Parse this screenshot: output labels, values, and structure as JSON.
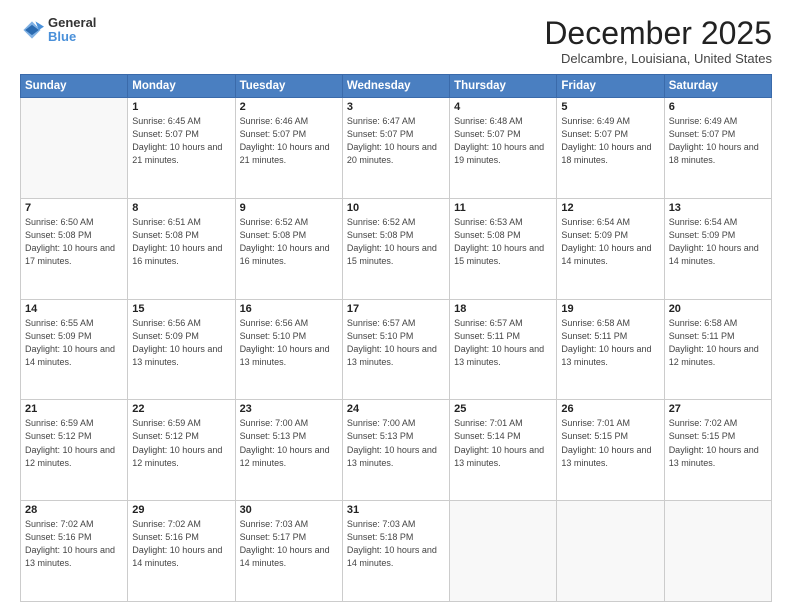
{
  "logo": {
    "general": "General",
    "blue": "Blue"
  },
  "header": {
    "month": "December 2025",
    "location": "Delcambre, Louisiana, United States"
  },
  "weekdays": [
    "Sunday",
    "Monday",
    "Tuesday",
    "Wednesday",
    "Thursday",
    "Friday",
    "Saturday"
  ],
  "weeks": [
    [
      {
        "day": "",
        "empty": true
      },
      {
        "day": "1",
        "sunrise": "6:45 AM",
        "sunset": "5:07 PM",
        "daylight": "10 hours and 21 minutes."
      },
      {
        "day": "2",
        "sunrise": "6:46 AM",
        "sunset": "5:07 PM",
        "daylight": "10 hours and 21 minutes."
      },
      {
        "day": "3",
        "sunrise": "6:47 AM",
        "sunset": "5:07 PM",
        "daylight": "10 hours and 20 minutes."
      },
      {
        "day": "4",
        "sunrise": "6:48 AM",
        "sunset": "5:07 PM",
        "daylight": "10 hours and 19 minutes."
      },
      {
        "day": "5",
        "sunrise": "6:49 AM",
        "sunset": "5:07 PM",
        "daylight": "10 hours and 18 minutes."
      },
      {
        "day": "6",
        "sunrise": "6:49 AM",
        "sunset": "5:07 PM",
        "daylight": "10 hours and 18 minutes."
      }
    ],
    [
      {
        "day": "7",
        "sunrise": "6:50 AM",
        "sunset": "5:08 PM",
        "daylight": "10 hours and 17 minutes."
      },
      {
        "day": "8",
        "sunrise": "6:51 AM",
        "sunset": "5:08 PM",
        "daylight": "10 hours and 16 minutes."
      },
      {
        "day": "9",
        "sunrise": "6:52 AM",
        "sunset": "5:08 PM",
        "daylight": "10 hours and 16 minutes."
      },
      {
        "day": "10",
        "sunrise": "6:52 AM",
        "sunset": "5:08 PM",
        "daylight": "10 hours and 15 minutes."
      },
      {
        "day": "11",
        "sunrise": "6:53 AM",
        "sunset": "5:08 PM",
        "daylight": "10 hours and 15 minutes."
      },
      {
        "day": "12",
        "sunrise": "6:54 AM",
        "sunset": "5:09 PM",
        "daylight": "10 hours and 14 minutes."
      },
      {
        "day": "13",
        "sunrise": "6:54 AM",
        "sunset": "5:09 PM",
        "daylight": "10 hours and 14 minutes."
      }
    ],
    [
      {
        "day": "14",
        "sunrise": "6:55 AM",
        "sunset": "5:09 PM",
        "daylight": "10 hours and 14 minutes."
      },
      {
        "day": "15",
        "sunrise": "6:56 AM",
        "sunset": "5:09 PM",
        "daylight": "10 hours and 13 minutes."
      },
      {
        "day": "16",
        "sunrise": "6:56 AM",
        "sunset": "5:10 PM",
        "daylight": "10 hours and 13 minutes."
      },
      {
        "day": "17",
        "sunrise": "6:57 AM",
        "sunset": "5:10 PM",
        "daylight": "10 hours and 13 minutes."
      },
      {
        "day": "18",
        "sunrise": "6:57 AM",
        "sunset": "5:11 PM",
        "daylight": "10 hours and 13 minutes."
      },
      {
        "day": "19",
        "sunrise": "6:58 AM",
        "sunset": "5:11 PM",
        "daylight": "10 hours and 13 minutes."
      },
      {
        "day": "20",
        "sunrise": "6:58 AM",
        "sunset": "5:11 PM",
        "daylight": "10 hours and 12 minutes."
      }
    ],
    [
      {
        "day": "21",
        "sunrise": "6:59 AM",
        "sunset": "5:12 PM",
        "daylight": "10 hours and 12 minutes."
      },
      {
        "day": "22",
        "sunrise": "6:59 AM",
        "sunset": "5:12 PM",
        "daylight": "10 hours and 12 minutes."
      },
      {
        "day": "23",
        "sunrise": "7:00 AM",
        "sunset": "5:13 PM",
        "daylight": "10 hours and 12 minutes."
      },
      {
        "day": "24",
        "sunrise": "7:00 AM",
        "sunset": "5:13 PM",
        "daylight": "10 hours and 13 minutes."
      },
      {
        "day": "25",
        "sunrise": "7:01 AM",
        "sunset": "5:14 PM",
        "daylight": "10 hours and 13 minutes."
      },
      {
        "day": "26",
        "sunrise": "7:01 AM",
        "sunset": "5:15 PM",
        "daylight": "10 hours and 13 minutes."
      },
      {
        "day": "27",
        "sunrise": "7:02 AM",
        "sunset": "5:15 PM",
        "daylight": "10 hours and 13 minutes."
      }
    ],
    [
      {
        "day": "28",
        "sunrise": "7:02 AM",
        "sunset": "5:16 PM",
        "daylight": "10 hours and 13 minutes."
      },
      {
        "day": "29",
        "sunrise": "7:02 AM",
        "sunset": "5:16 PM",
        "daylight": "10 hours and 14 minutes."
      },
      {
        "day": "30",
        "sunrise": "7:03 AM",
        "sunset": "5:17 PM",
        "daylight": "10 hours and 14 minutes."
      },
      {
        "day": "31",
        "sunrise": "7:03 AM",
        "sunset": "5:18 PM",
        "daylight": "10 hours and 14 minutes."
      },
      {
        "day": "",
        "empty": true
      },
      {
        "day": "",
        "empty": true
      },
      {
        "day": "",
        "empty": true
      }
    ]
  ],
  "labels": {
    "sunrise": "Sunrise:",
    "sunset": "Sunset:",
    "daylight": "Daylight:"
  }
}
